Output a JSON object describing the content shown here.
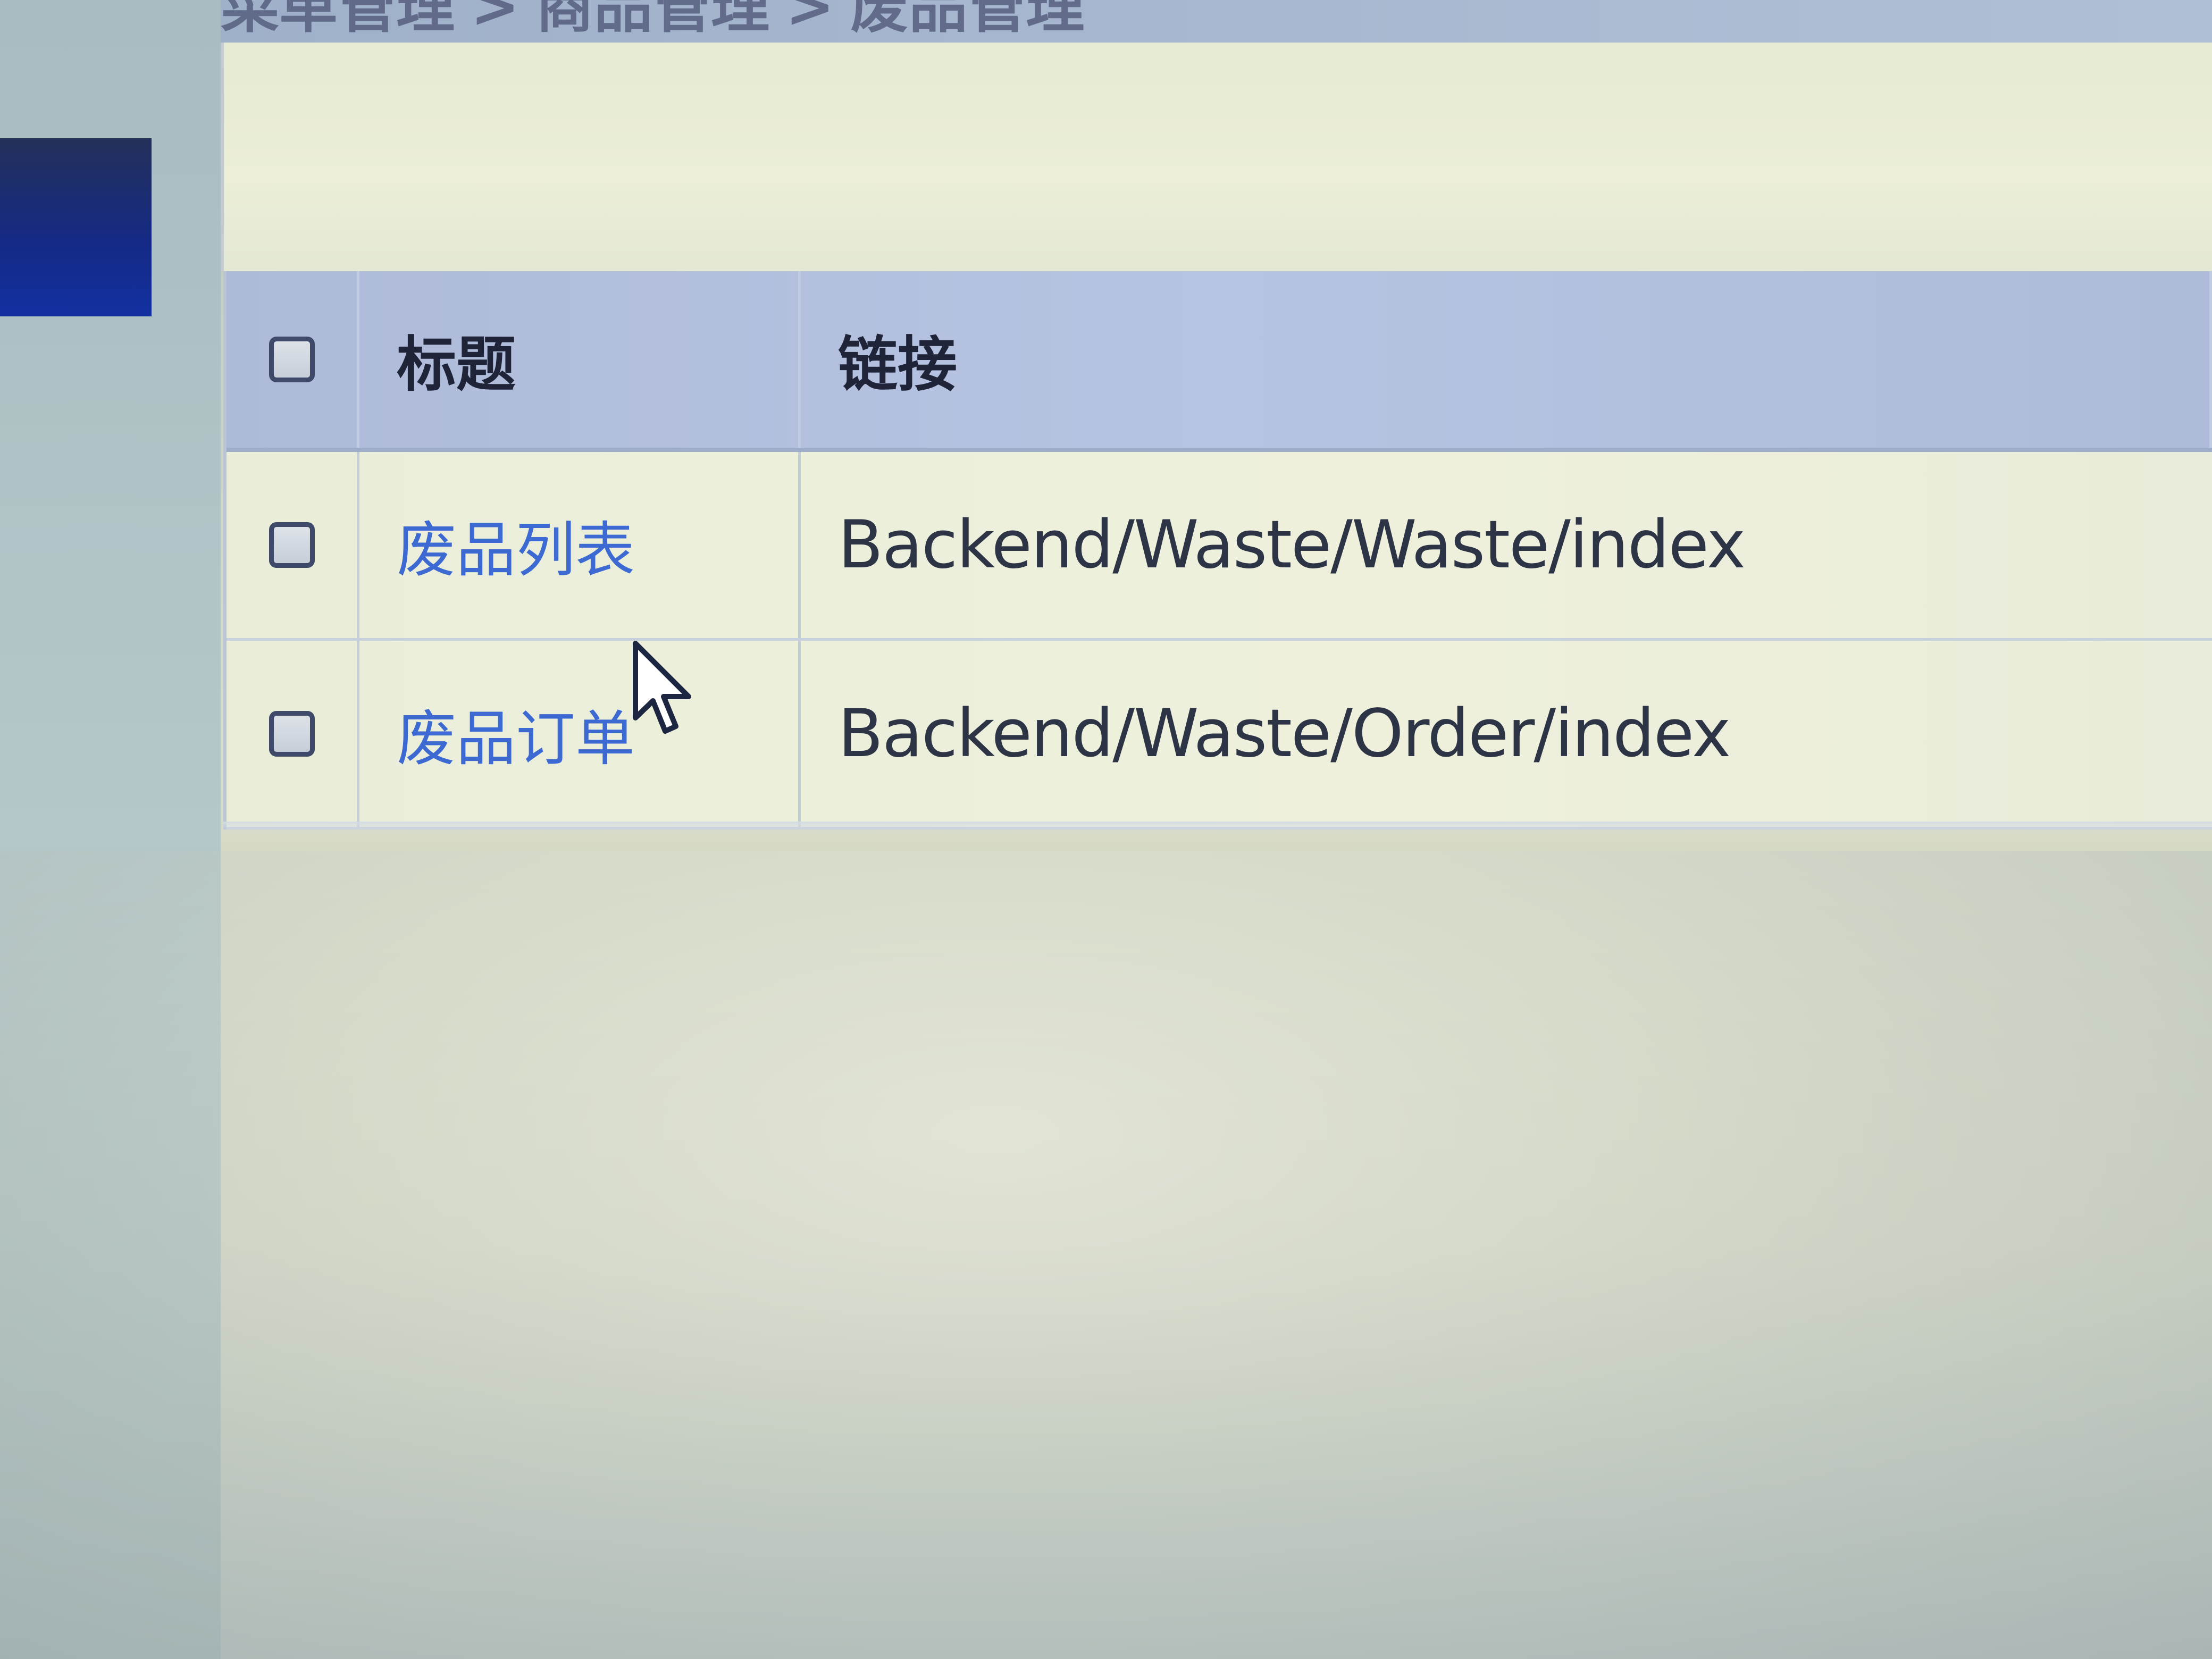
{
  "breadcrumb": {
    "items": [
      "菜单管理",
      "商品管理",
      "废品管理"
    ],
    "separator": ">"
  },
  "table": {
    "headers": {
      "title": "标题",
      "link": "链接"
    },
    "rows": [
      {
        "title": "废品列表",
        "link": "Backend/Waste/Waste/index"
      },
      {
        "title": "废品订单",
        "link": "Backend/Waste/Order/index"
      }
    ]
  },
  "colors": {
    "header_background": "#b6c3e2",
    "row_background": "#eef0dc",
    "link_color": "#3c6ad2",
    "nav_active": "#1230a0"
  },
  "icons": {
    "cursor": "mouse-pointer-icon",
    "checkbox": "checkbox-icon"
  }
}
